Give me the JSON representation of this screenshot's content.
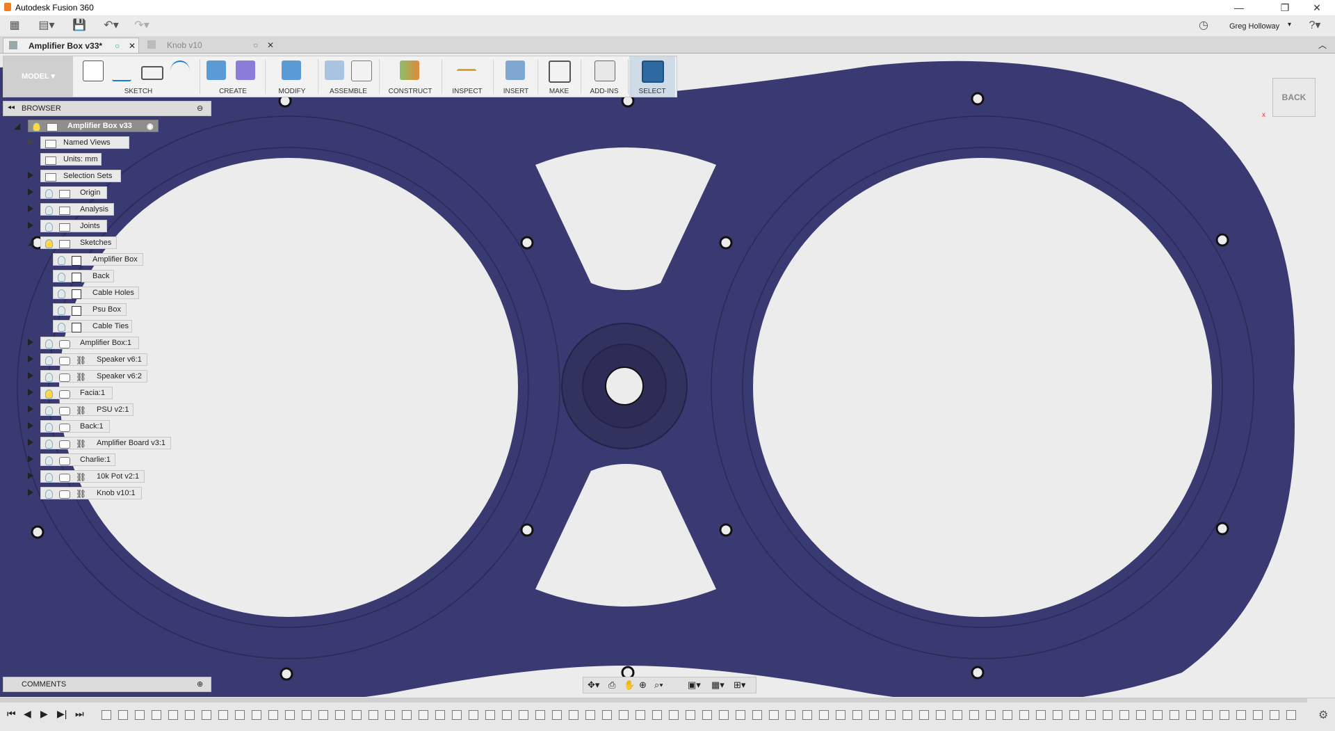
{
  "app": {
    "title": "Autodesk Fusion 360"
  },
  "window": {
    "user": "Greg Holloway"
  },
  "tabs": [
    {
      "label": "Amplifier Box v33*",
      "active": true
    },
    {
      "label": "Knob v10",
      "active": false
    }
  ],
  "ribbon": {
    "workspace": "MODEL",
    "groups": [
      "SKETCH",
      "CREATE",
      "MODIFY",
      "ASSEMBLE",
      "CONSTRUCT",
      "INSPECT",
      "INSERT",
      "MAKE",
      "ADD-INS",
      "SELECT"
    ]
  },
  "browser": {
    "title": "BROWSER",
    "root": "Amplifier Box v33",
    "items": [
      "Named Views",
      "Units: mm",
      "Selection Sets",
      "Origin",
      "Analysis",
      "Joints",
      "Sketches",
      "Amplifier Box",
      "Back",
      "Cable Holes",
      "Psu Box",
      "Cable Ties",
      "Amplifier Box:1",
      "Speaker v6:1",
      "Speaker v6:2",
      "Facia:1",
      "PSU v2:1",
      "Back:1",
      "Amplifier Board v3:1",
      "Charlie:1",
      "10k Pot v2:1",
      "Knob v10:1"
    ]
  },
  "comments": {
    "title": "COMMENTS"
  },
  "viewcube": {
    "face": "BACK"
  },
  "colors": {
    "model": "#3a3a72",
    "accent": "#0696d7"
  }
}
